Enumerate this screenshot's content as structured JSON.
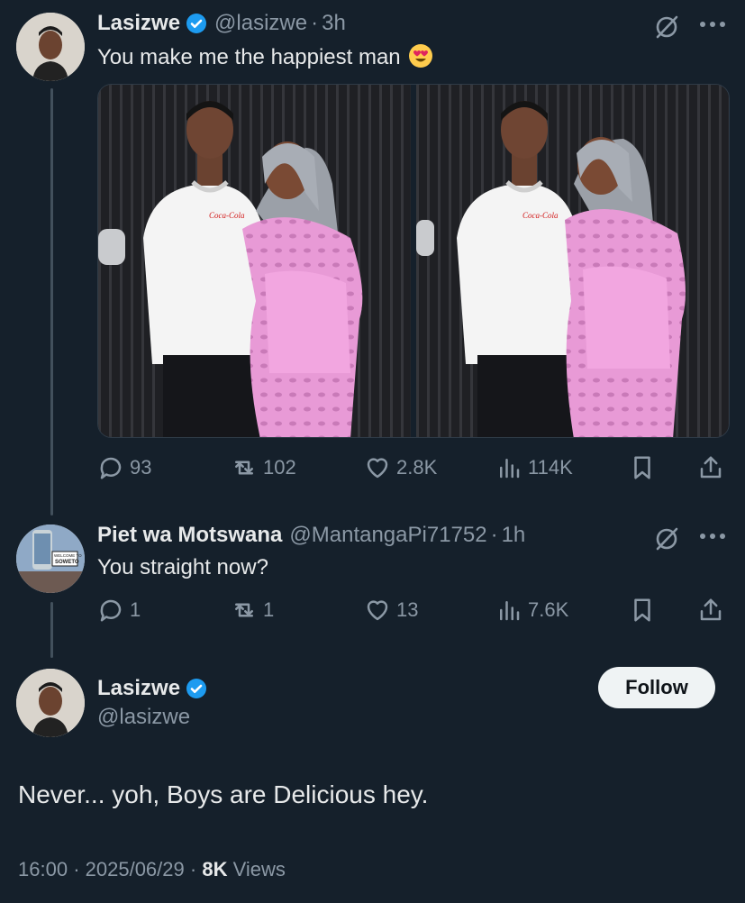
{
  "tweet1": {
    "name": "Lasizwe",
    "handle": "@lasizwe",
    "time": "3h",
    "text": "You make me the happiest man",
    "stats": {
      "replies": "93",
      "retweets": "102",
      "likes": "2.8K",
      "views": "114K"
    }
  },
  "tweet2": {
    "name": "Piet wa Motswana",
    "handle": "@MantangaPi71752",
    "time": "1h",
    "text": "You straight now?",
    "avatar_sign_top": "WELCOME TO",
    "avatar_sign": "SOWETO",
    "stats": {
      "replies": "1",
      "retweets": "1",
      "likes": "13",
      "views": "7.6K"
    }
  },
  "main": {
    "name": "Lasizwe",
    "handle": "@lasizwe",
    "follow_label": "Follow",
    "text": "Never... yoh, Boys are Delicious hey.",
    "time": "16:00",
    "date": "2025/06/29",
    "views_count": "8K",
    "views_label": "Views"
  },
  "photo_shirt_logo": "Coca-Cola",
  "colors": {
    "background": "#15202b",
    "muted": "#8b98a5",
    "verified": "#1d9bf0"
  }
}
